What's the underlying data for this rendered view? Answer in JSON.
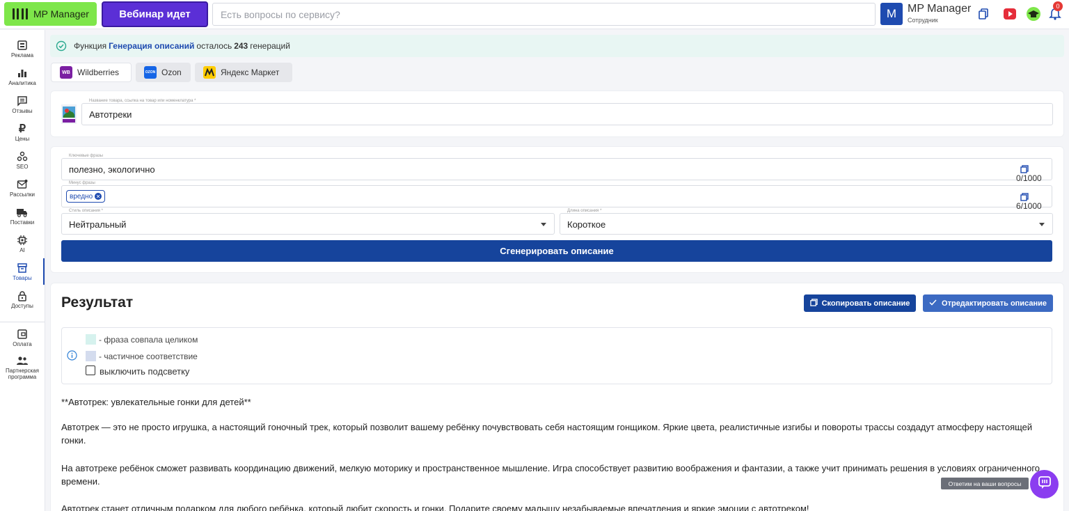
{
  "header": {
    "logo_label": "MP Manager",
    "webinar_label": "Вебинар идет",
    "search_placeholder": "Есть вопросы по сервису?",
    "avatar_letter": "M",
    "user_name": "MP Manager",
    "user_role": "Сотрудник",
    "notifications_count": "0"
  },
  "sidebar": {
    "items": [
      {
        "label": "Реклама",
        "icon": "ads-icon"
      },
      {
        "label": "Аналитика",
        "icon": "bar-chart-icon"
      },
      {
        "label": "Отзывы",
        "icon": "reviews-icon"
      },
      {
        "label": "Цены",
        "icon": "ruble-icon"
      },
      {
        "label": "SEO",
        "icon": "seo-icon"
      },
      {
        "label": "Рассылки",
        "icon": "mail-icon"
      },
      {
        "label": "Поставки",
        "icon": "truck-icon"
      },
      {
        "label": "AI",
        "icon": "chip-icon"
      },
      {
        "label": "Товары",
        "icon": "box-icon",
        "active": true
      },
      {
        "label": "Доступы",
        "icon": "lock-icon"
      },
      {
        "label": "Оплата",
        "icon": "wallet-icon"
      },
      {
        "label": "Партнерская программа",
        "icon": "partners-icon"
      }
    ]
  },
  "notice": {
    "prefix": "Функция",
    "feature": "Генерация описаний",
    "middle": "осталось",
    "count": "243",
    "suffix": "генераций"
  },
  "marketplaces": [
    {
      "label": "Wildberries",
      "badge": "WB",
      "color": "#7b1fa2"
    },
    {
      "label": "Ozon",
      "badge": "OZON",
      "color": "#1565e6"
    },
    {
      "label": "Яндекс Маркет",
      "badge": "",
      "color": "#ffcc00"
    }
  ],
  "product": {
    "label": "Название товара, ссылка на товар или номенклатура *",
    "value": "Автотреки"
  },
  "form": {
    "keywords_label": "Ключевые фразы",
    "keywords_value": "полезно, экологично",
    "keywords_counter": "0/1000",
    "minus_label": "Минус фразы",
    "minus_chip": "вредно",
    "minus_counter": "6/1000",
    "style_label": "Стиль описания *",
    "style_value": "Нейтральный",
    "length_label": "Длина описания *",
    "length_value": "Короткое",
    "generate_label": "Сгенерировать описание"
  },
  "result": {
    "title": "Результат",
    "copy_label": "Скопировать описание",
    "edit_label": "Отредактировать описание",
    "legend_full": "- фраза совпала целиком",
    "legend_partial": "- частичное соответствие",
    "legend_toggle": "выключить подсветку",
    "full_color": "#d6f2ee",
    "partial_color": "#d4dcee",
    "paragraphs": [
      "**Автотрек: увлекательные гонки для детей**",
      "Автотрек — это не просто игрушка, а настоящий гоночный трек, который позволит вашему ребёнку почувствовать себя настоящим гонщиком. Яркие цвета, реалистичные изгибы и повороты трассы создадут атмосферу настоящей гонки.",
      "На автотреке ребёнок сможет развивать координацию движений, мелкую моторику и пространственное мышление. Игра способствует развитию воображения и фантазии, а также учит принимать решения в условиях ограниченного времени.",
      "Автотрек станет отличным подарком для любого ребёнка, который любит скорость и гонки. Подарите своему малышу незабываемые впечатления и яркие эмоции с автотреком!"
    ]
  },
  "chat": {
    "tooltip": "Ответим на ваши вопросы"
  }
}
